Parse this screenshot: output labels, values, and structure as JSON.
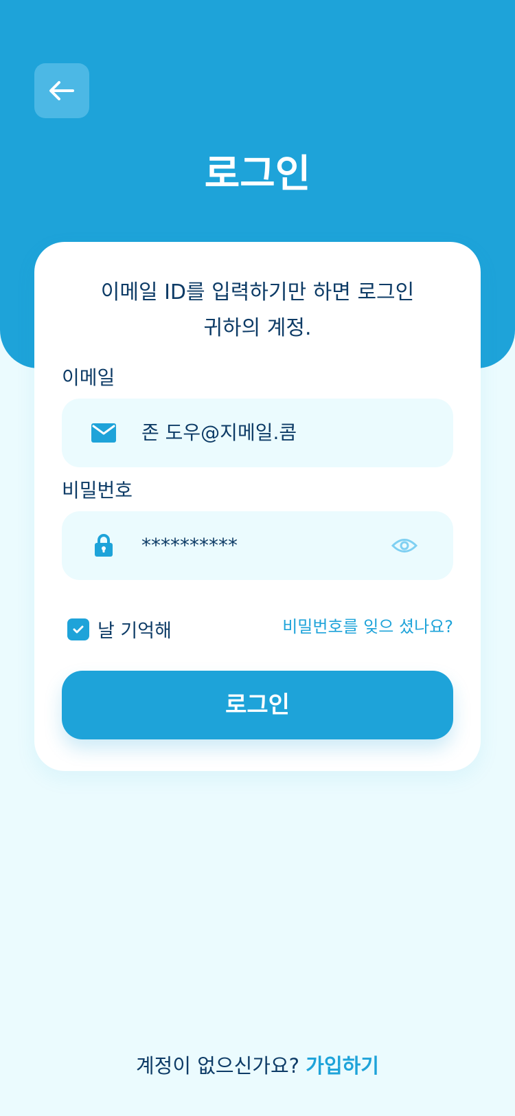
{
  "header": {
    "back_icon": "arrow-left-icon",
    "title": "로그인"
  },
  "card": {
    "description": "이메일 ID를 입력하기만 하면 로그인\n귀하의 계정.",
    "email": {
      "label": "이메일",
      "icon": "mail-icon",
      "value": "존 도우@지메일.콤"
    },
    "password": {
      "label": "비밀번호",
      "icon": "lock-icon",
      "value": "**********",
      "toggle_icon": "eye-icon"
    },
    "remember": {
      "label": "날 기억해",
      "checked": true
    },
    "forgot_link": "비밀번호를 잊으 셨나요?",
    "login_button": "로그인"
  },
  "footer": {
    "prompt": "계정이 없으신가요? ",
    "signup_link": "가입하기"
  },
  "colors": {
    "primary": "#1ea3d9",
    "background": "#ebfbfe",
    "text": "#0d3b66",
    "card": "#ffffff"
  }
}
